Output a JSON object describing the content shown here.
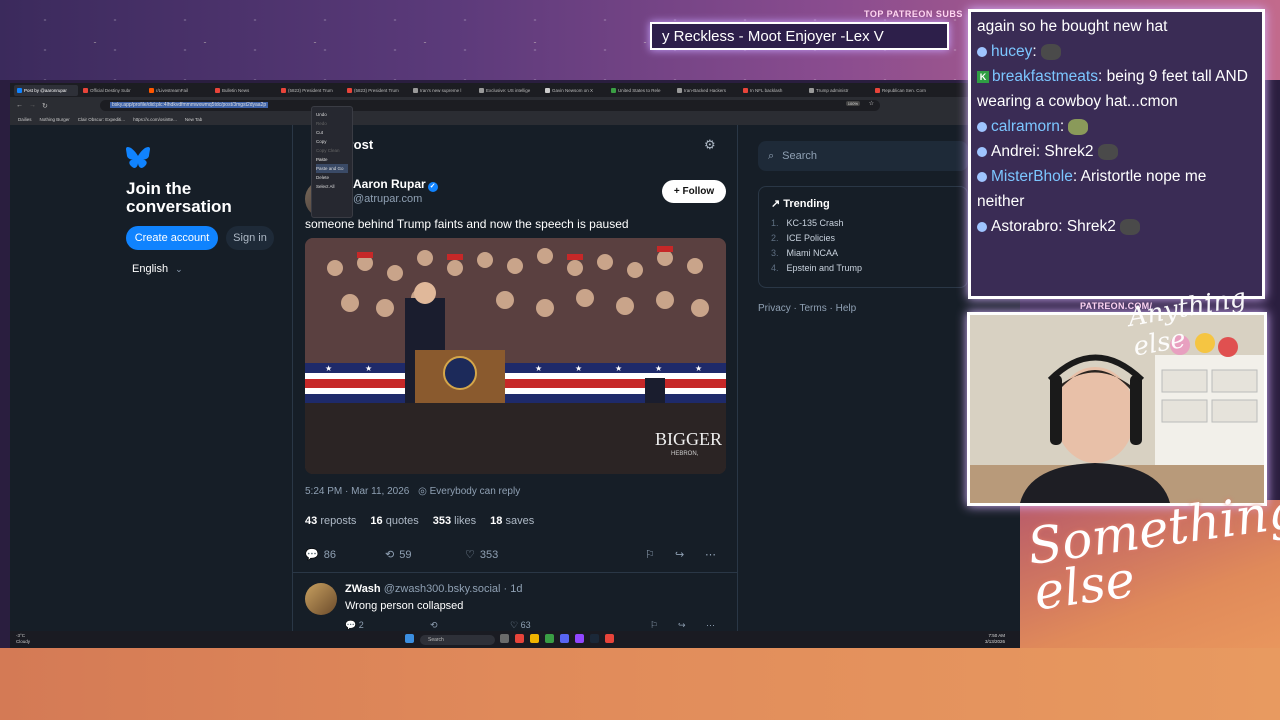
{
  "overlay": {
    "patreon_label": "TOP PATREON SUBS",
    "ticker_text": "y Reckless - Moot Enjoyer -Lex V",
    "patreon_url": "PATREON.COM/",
    "script_logo": "Something else",
    "script_logo_small": "Anything else"
  },
  "browser": {
    "tabs": [
      {
        "label": "Post by @aaronrupar",
        "color": "#1083fe",
        "active": true
      },
      {
        "label": "Official Destiny Subr",
        "color": "#e8443a",
        "active": false
      },
      {
        "label": "r/LivestreamFail",
        "color": "#ff5700",
        "active": false
      },
      {
        "label": "Bulletin News",
        "color": "#e8443a",
        "active": false
      },
      {
        "label": "(5823) President Trum",
        "color": "#e8443a",
        "active": false
      },
      {
        "label": "(5823) President Trum",
        "color": "#e8443a",
        "active": false
      },
      {
        "label": "Iran's new supreme l",
        "color": "#999",
        "active": false
      },
      {
        "label": "Exclusive: US intellige",
        "color": "#999",
        "active": false
      },
      {
        "label": "Gavin Newsom on X",
        "color": "#ccc",
        "active": false
      },
      {
        "label": "United States to Rele",
        "color": "#3a9e44",
        "active": false
      },
      {
        "label": "Iran-Backed Hackers",
        "color": "#999",
        "active": false
      },
      {
        "label": "In NFL backlash",
        "color": "#e8443a",
        "active": false
      },
      {
        "label": "Trump administr",
        "color": "#999",
        "active": false
      },
      {
        "label": "Republican Sen. Corn",
        "color": "#e8443a",
        "active": false
      }
    ],
    "url": "bsky.app/profile/did:plc:4lhdkvdfmmmwxwmq5tdc/post/3mgst2dyaa2p",
    "zoom": "100%",
    "bookmarks": [
      "Dailies",
      "Nothing Burger",
      "Clair Obscur: Expediti...",
      "https://x.com/osintte...",
      "New Tab"
    ]
  },
  "context_menu": {
    "items": [
      {
        "label": "Undo",
        "disabled": false
      },
      {
        "label": "Redo",
        "disabled": true
      },
      {
        "label": "Cut",
        "disabled": false
      },
      {
        "label": "Copy",
        "disabled": false
      },
      {
        "label": "Copy Clean Link",
        "disabled": true
      },
      {
        "label": "Paste",
        "disabled": false
      },
      {
        "label": "Paste and Go",
        "disabled": false
      },
      {
        "label": "Delete",
        "disabled": false
      },
      {
        "label": "Select All",
        "disabled": false
      }
    ]
  },
  "sidebar": {
    "join_title": "Join the conversation",
    "create_account": "Create account",
    "sign_in": "Sign in",
    "language": "English"
  },
  "post": {
    "header_title": "Post",
    "author_name": "Aaron Rupar",
    "handle": "@atrupar.com",
    "follow_label": "+ Follow",
    "text": "someone behind Trump faints and now the speech is paused",
    "media_sign": "BIGGER PA",
    "media_sign2": "HEBRON,",
    "time": "5:24 PM · Mar 11, 2026",
    "reply_setting": "Everybody can reply",
    "reposts": "43",
    "reposts_label": "reposts",
    "quotes": "16",
    "quotes_label": "quotes",
    "likes": "353",
    "likes_label": "likes",
    "saves": "18",
    "saves_label": "saves",
    "reply_count": "86",
    "repost_count": "59",
    "like_count": "353"
  },
  "reply": {
    "author": "ZWash",
    "handle": "@zwash300.bsky.social · 1d",
    "text": "Wrong person collapsed",
    "reply_count": "2",
    "like_count": "63"
  },
  "right": {
    "search_placeholder": "Search",
    "trending_title": "Trending",
    "trends": [
      {
        "n": "1.",
        "label": "KC-135 Crash"
      },
      {
        "n": "2.",
        "label": "ICE Policies"
      },
      {
        "n": "3.",
        "label": "Miami NCAA"
      },
      {
        "n": "4.",
        "label": "Epstein and Trump"
      }
    ],
    "footer": "Privacy · Terms · Help"
  },
  "taskbar": {
    "weather_temp": "-3°C",
    "weather_desc": "Cloudy",
    "search": "Search",
    "time": "7:50 AM",
    "date": "3/13/2026"
  },
  "chat": {
    "lines": [
      {
        "user": "",
        "text": "again so he bought new hat",
        "emote": false
      },
      {
        "user": "hucey",
        "text": ":",
        "emote": true
      },
      {
        "user": "breakfastmeats",
        "text": ": being 9 feet tall AND wearing a cowboy hat...cmon",
        "emote": false,
        "badge": "K"
      },
      {
        "user": "calramorn",
        "text": ":",
        "emote": true
      },
      {
        "user": "Andrei",
        "text": ": Shrek2",
        "emote": true,
        "plain": true
      },
      {
        "user": "MisterBhole",
        "text": ": Aristortle nope me neither",
        "emote": false
      },
      {
        "user": "Astorabro",
        "text": ": Shrek2",
        "emote": true,
        "plain": true
      }
    ]
  },
  "colors": {
    "bsky_blue": "#1083fe",
    "page_bg": "#161e27",
    "chat_border": "#ffffff"
  }
}
